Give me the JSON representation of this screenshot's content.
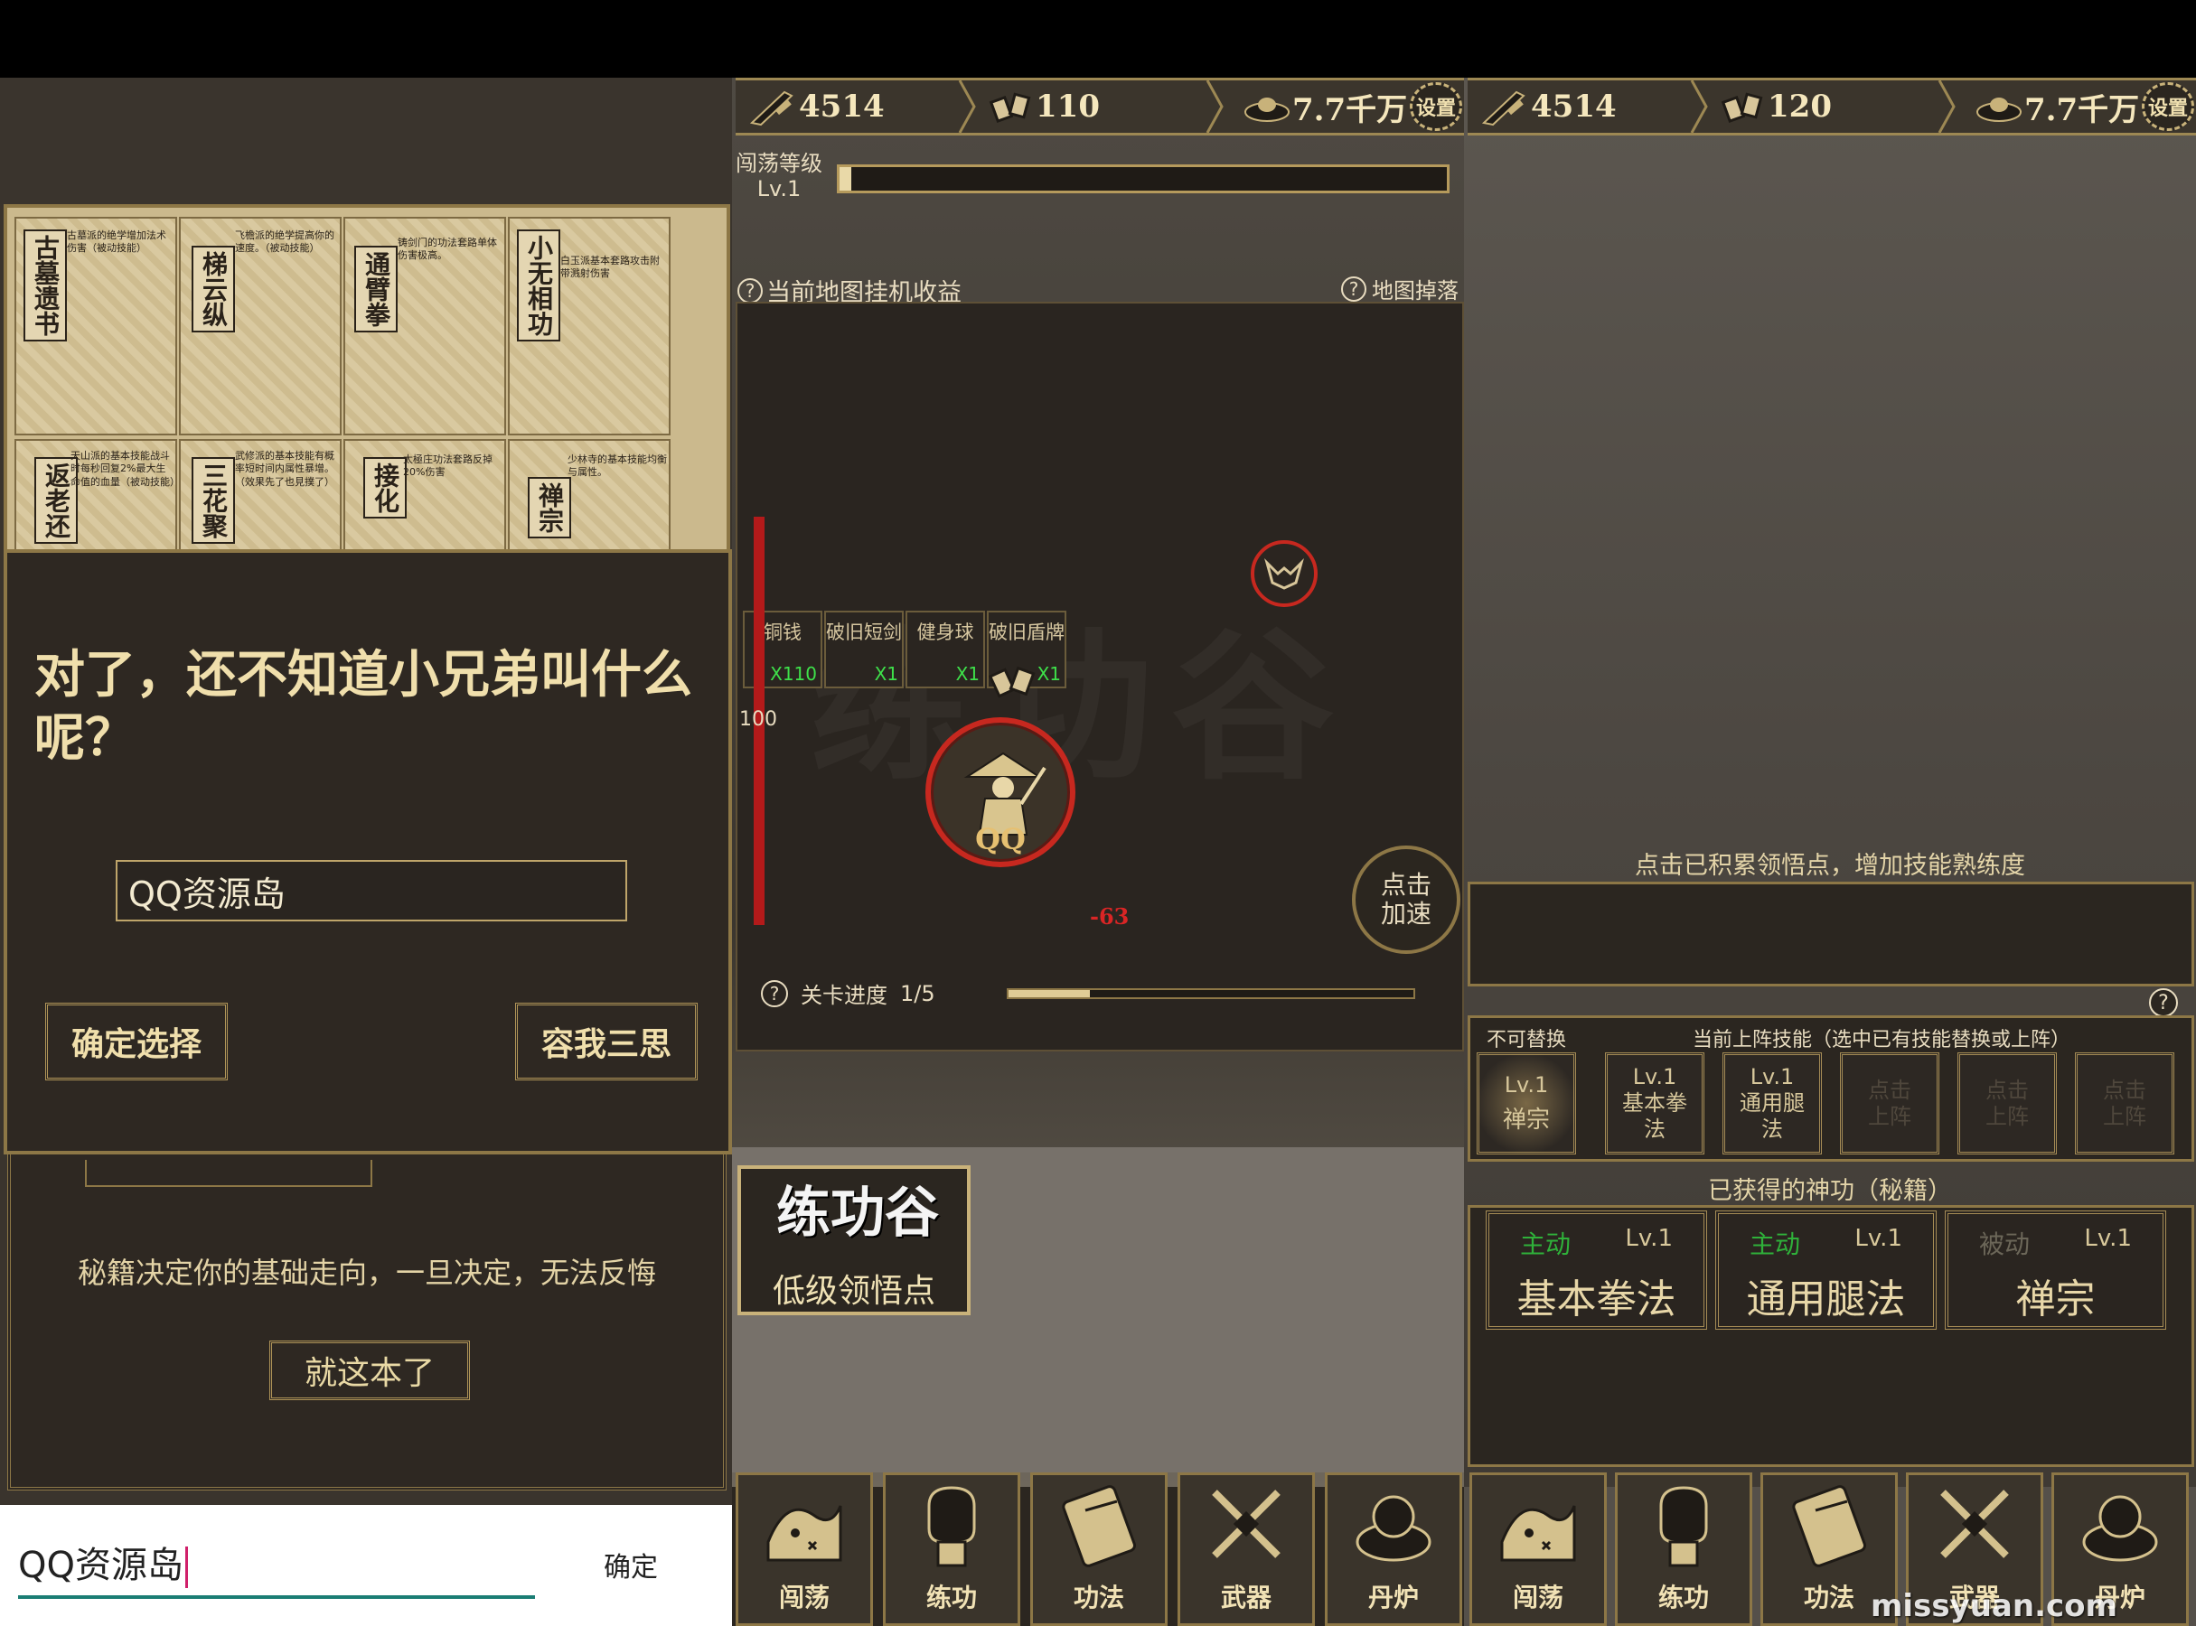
{
  "panel1": {
    "cards": [
      {
        "title": "古墓遗书",
        "desc": "古墓派的绝学增加法术伤害（被动技能）"
      },
      {
        "title": "梯云纵",
        "desc": "飞檐派的绝学提高你的速度。（被动技能）"
      },
      {
        "title": "通臂拳",
        "desc": "铸剑门的功法套路单体伤害极高。"
      },
      {
        "title": "小无相功",
        "desc": "白玉派基本套路攻击附带溅射伤害"
      },
      {
        "title": "返老还",
        "desc": "天山派的基本技能战斗时每秒回复2%最大生命值的血量（被动技能）"
      },
      {
        "title": "三花聚",
        "desc": "武修派的基本技能有概率短时间内属性暴增。（效果先了也見撲了）"
      },
      {
        "title": "接化",
        "desc": "太極庄功法套路反掉20%伤害"
      },
      {
        "title": "禅宗",
        "desc": "少林寺的基本技能均衡与属性。"
      }
    ],
    "dialog": {
      "question": "对了，还不知道小兄弟叫什么呢？",
      "name_value": "QQ资源岛",
      "confirm_label": "确定选择",
      "think_label": "容我三思"
    },
    "notice": "秘籍决定你的基础走向，一旦决定，无法反悔",
    "this_one_label": "就这本了",
    "keyboard_input_value": "QQ资源岛",
    "keyboard_ok_label": "确定"
  },
  "panel2": {
    "resources": {
      "power": "4514",
      "ingot": "110",
      "gold": "7.7千万",
      "settings": "设置"
    },
    "level_label": "闯荡等级",
    "level_value": "Lv.1",
    "level_progress": 0.02,
    "idle_title": "当前地图挂机收益",
    "drops_title": "地图掉落",
    "drops": [
      {
        "name": "铜钱",
        "qty": "X110"
      },
      {
        "name": "破旧短剑",
        "qty": "X1"
      },
      {
        "name": "健身球",
        "qty": "X1"
      },
      {
        "name": "破旧盾牌",
        "qty": "X1"
      }
    ],
    "hp_value": "100",
    "player_name": "QQ",
    "damage": "-63",
    "speed_label_1": "点击",
    "speed_label_2": "加速",
    "stage_label": "关卡进度",
    "stage_value": "1/5",
    "stage_progress": 0.2,
    "watermark": "练功谷",
    "popup_title": "练功谷",
    "popup_label": "低级领悟点"
  },
  "panel3": {
    "resources": {
      "power": "4514",
      "ingot": "120",
      "gold": "7.7千万",
      "settings": "设置"
    },
    "hint": "点击已积累领悟点，增加技能熟练度",
    "irreplaceable": "不可替换",
    "equipped_title": "当前上阵技能（选中已有技能替换或上阵）",
    "slots": [
      {
        "lv": "Lv.1",
        "name": "禅宗",
        "active": true
      },
      {
        "lv": "Lv.1",
        "name": "基本拳法"
      },
      {
        "lv": "Lv.1",
        "name": "通用腿法"
      },
      {
        "lv": "",
        "name": "点击上阵",
        "dim": true
      },
      {
        "lv": "",
        "name": "点击上阵",
        "dim": true
      },
      {
        "lv": "",
        "name": "点击上阵",
        "dim": true
      }
    ],
    "obtained_title": "已获得的神功（秘籍）",
    "books": [
      {
        "tag": "主动",
        "lv": "Lv.1",
        "name": "基本拳法",
        "tag_color": "#2fb13a"
      },
      {
        "tag": "主动",
        "lv": "Lv.1",
        "name": "通用腿法",
        "tag_color": "#2fb13a"
      },
      {
        "tag": "被动",
        "lv": "Lv.1",
        "name": "禅宗",
        "tag_color": "#6b6658"
      }
    ]
  },
  "nav": [
    "闯荡",
    "练功",
    "功法",
    "武器",
    "丹炉"
  ],
  "watermark_site": "missyuan.com"
}
